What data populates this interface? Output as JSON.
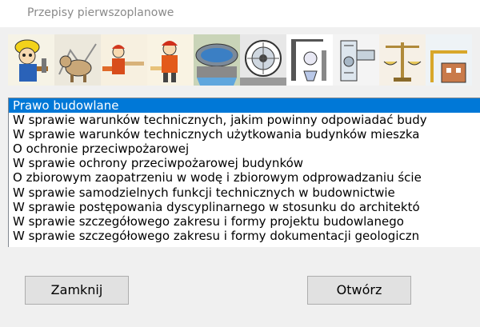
{
  "window": {
    "title": "Przepisy pierwszoplanowe"
  },
  "banner": {
    "tiles": [
      "worker-icon",
      "dog-icon",
      "firefighters-icon",
      "firefighter-icon",
      "water-reservoir-icon",
      "turbine-icon",
      "lab-apparatus-icon",
      "ventilation-icon",
      "scales-icon",
      "construction-icon"
    ]
  },
  "list": {
    "selected_index": 0,
    "items": [
      "Prawo budowlane",
      "W sprawie warunków technicznych, jakim powinny odpowiadać budy",
      "W sprawie warunków technicznych użytkowania budynków mieszka",
      "O ochronie przeciwpożarowej",
      "W sprawie ochrony przeciwpożarowej budynków",
      "O zbiorowym zaopatrzeniu w wodę i zbiorowym odprowadzaniu ście",
      "W sprawie samodzielnych funkcji technicznych w budownictwie",
      "W sprawie postępowania dyscyplinarnego w stosunku do architektó",
      "W sprawie szczegółowego zakresu i formy projektu budowlanego",
      "W sprawie szczegółowego zakresu i formy dokumentacji geologiczn"
    ]
  },
  "buttons": {
    "close_label": "Zamknij",
    "open_label": "Otwórz"
  },
  "colors": {
    "selection": "#0078d7",
    "window_bg": "#f0f0f0"
  }
}
